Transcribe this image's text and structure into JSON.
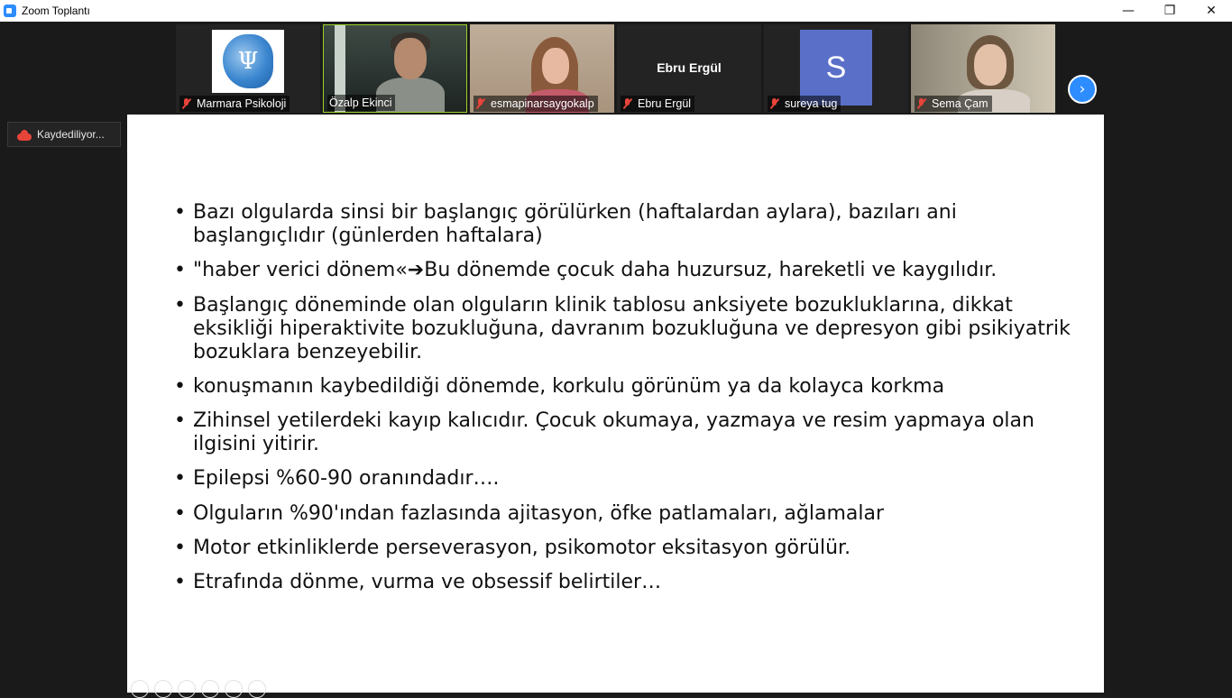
{
  "window": {
    "title": "Zoom Toplantı",
    "controls": {
      "minimize": "—",
      "restore": "❐",
      "close": "✕"
    }
  },
  "participants": [
    {
      "name": "Marmara Psikoloji",
      "muted": true,
      "display": "logo",
      "logo_glyph": "Ψ"
    },
    {
      "name": "Özalp Ekinci",
      "muted": false,
      "display": "video",
      "active_speaker": true
    },
    {
      "name": "esmapinarsaygokalp",
      "muted": true,
      "display": "video"
    },
    {
      "name": "Ebru Ergül",
      "muted": true,
      "display": "name",
      "display_name": "Ebru Ergül"
    },
    {
      "name": "sureya tug",
      "muted": true,
      "display": "avatar",
      "avatar_letter": "S"
    },
    {
      "name": "Sema Çam",
      "muted": true,
      "display": "video"
    }
  ],
  "gallery": {
    "next_icon": "›"
  },
  "recording": {
    "label": "Kaydediliyor..."
  },
  "slide": {
    "bullets": [
      "Bazı olgularda sinsi bir başlangıç görülürken (haftalardan aylara), bazıları ani başlangıçlıdır (günlerden haftalara)",
      {
        "before": "\"haber verici dönem«",
        "arrow": "➔",
        "after": "Bu dönemde çocuk daha huzursuz, hareketli ve kaygılıdır."
      },
      "Başlangıç döneminde olan olguların klinik tablosu anksiyete bozukluklarına, dikkat eksikliği hiperaktivite bozukluğuna, davranım bozukluğuna ve depresyon gibi psikiyatrik bozuklara benzeyebilir.",
      "konuşmanın kaybedildiği dönemde, korkulu görünüm ya da kolayca korkma",
      "Zihinsel yetilerdeki kayıp kalıcıdır. Çocuk okumaya, yazmaya ve resim yapmaya olan ilgisini yitirir.",
      "Epilepsi %60-90 oranındadır….",
      "Olguların %90'ından fazlasında ajitasyon, öfke patlamaları, ağlamalar",
      "Motor etkinliklerde perseverasyon, psikomotor eksitasyon görülür.",
      "Etrafında dönme, vurma ve obsessif belirtiler…"
    ]
  },
  "colors": {
    "zoom_blue": "#2d8cff",
    "mute_red": "#e8443a",
    "active_speaker": "#9bd12a",
    "avatar_bg": "#5a70c8",
    "background": "#1a1a1a"
  }
}
